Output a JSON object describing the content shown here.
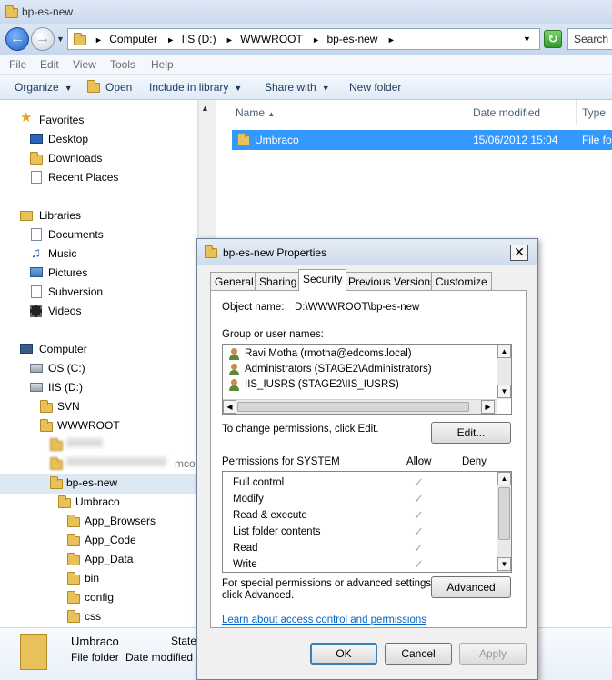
{
  "window": {
    "title": "bp-es-new"
  },
  "address": {
    "crumbs": [
      "Computer",
      "IIS (D:)",
      "WWWROOT",
      "bp-es-new"
    ],
    "search_placeholder": "Search b"
  },
  "menu": [
    "File",
    "Edit",
    "View",
    "Tools",
    "Help"
  ],
  "commands": {
    "organize": "Organize",
    "open": "Open",
    "include": "Include in library",
    "share": "Share with",
    "new_folder": "New folder"
  },
  "nav": {
    "favorites": "Favorites",
    "desktop": "Desktop",
    "downloads": "Downloads",
    "recent": "Recent Places",
    "libraries": "Libraries",
    "documents": "Documents",
    "music": "Music",
    "pictures": "Pictures",
    "subversion": "Subversion",
    "videos": "Videos",
    "computer": "Computer",
    "os_c": "OS (C:)",
    "iis_d": "IIS (D:)",
    "svn": "SVN",
    "wwwroot": "WWWROOT",
    "blur2": "mco",
    "bp_es_new": "bp-es-new",
    "umbraco": "Umbraco",
    "app_browsers": "App_Browsers",
    "app_code": "App_Code",
    "app_data": "App_Data",
    "bin": "bin",
    "config": "config",
    "css": "css"
  },
  "columns": {
    "name": "Name",
    "date": "Date modified",
    "type": "Type"
  },
  "files": [
    {
      "name": "Umbraco",
      "date": "15/06/2012 15:04",
      "type": "File fol"
    }
  ],
  "details": {
    "name": "Umbraco",
    "type": "File folder",
    "date_label": "Date modified",
    "state_label": "State"
  },
  "dialog": {
    "title": "bp-es-new Properties",
    "tabs": [
      "General",
      "Sharing",
      "Security",
      "Previous Versions",
      "Customize"
    ],
    "object_label": "Object name:",
    "object_value": "D:\\WWWROOT\\bp-es-new",
    "group_label": "Group or user names:",
    "users": [
      "Ravi Motha (rmotha@edcoms.local)",
      "Administrators (STAGE2\\Administrators)",
      "IIS_IUSRS (STAGE2\\IIS_IUSRS)"
    ],
    "change_text": "To change permissions, click Edit.",
    "edit_button": "Edit...",
    "perm_label": "Permissions for SYSTEM",
    "allow_label": "Allow",
    "deny_label": "Deny",
    "permissions": [
      "Full control",
      "Modify",
      "Read & execute",
      "List folder contents",
      "Read",
      "Write"
    ],
    "special_text_1": "For special permissions or advanced settings,",
    "special_text_2": "click Advanced.",
    "advanced_button": "Advanced",
    "learn_link": "Learn about access control and permissions",
    "ok": "OK",
    "cancel": "Cancel",
    "apply": "Apply"
  }
}
